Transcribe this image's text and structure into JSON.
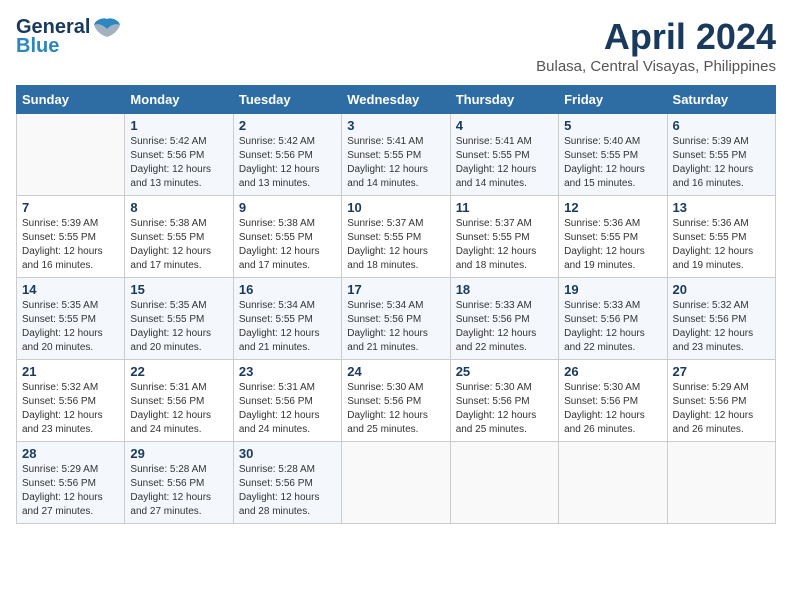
{
  "logo": {
    "line1": "General",
    "line2": "Blue"
  },
  "title": "April 2024",
  "subtitle": "Bulasa, Central Visayas, Philippines",
  "days_header": [
    "Sunday",
    "Monday",
    "Tuesday",
    "Wednesday",
    "Thursday",
    "Friday",
    "Saturday"
  ],
  "weeks": [
    [
      {
        "day": "",
        "info": ""
      },
      {
        "day": "1",
        "info": "Sunrise: 5:42 AM\nSunset: 5:56 PM\nDaylight: 12 hours\nand 13 minutes."
      },
      {
        "day": "2",
        "info": "Sunrise: 5:42 AM\nSunset: 5:56 PM\nDaylight: 12 hours\nand 13 minutes."
      },
      {
        "day": "3",
        "info": "Sunrise: 5:41 AM\nSunset: 5:55 PM\nDaylight: 12 hours\nand 14 minutes."
      },
      {
        "day": "4",
        "info": "Sunrise: 5:41 AM\nSunset: 5:55 PM\nDaylight: 12 hours\nand 14 minutes."
      },
      {
        "day": "5",
        "info": "Sunrise: 5:40 AM\nSunset: 5:55 PM\nDaylight: 12 hours\nand 15 minutes."
      },
      {
        "day": "6",
        "info": "Sunrise: 5:39 AM\nSunset: 5:55 PM\nDaylight: 12 hours\nand 16 minutes."
      }
    ],
    [
      {
        "day": "7",
        "info": "Sunrise: 5:39 AM\nSunset: 5:55 PM\nDaylight: 12 hours\nand 16 minutes."
      },
      {
        "day": "8",
        "info": "Sunrise: 5:38 AM\nSunset: 5:55 PM\nDaylight: 12 hours\nand 17 minutes."
      },
      {
        "day": "9",
        "info": "Sunrise: 5:38 AM\nSunset: 5:55 PM\nDaylight: 12 hours\nand 17 minutes."
      },
      {
        "day": "10",
        "info": "Sunrise: 5:37 AM\nSunset: 5:55 PM\nDaylight: 12 hours\nand 18 minutes."
      },
      {
        "day": "11",
        "info": "Sunrise: 5:37 AM\nSunset: 5:55 PM\nDaylight: 12 hours\nand 18 minutes."
      },
      {
        "day": "12",
        "info": "Sunrise: 5:36 AM\nSunset: 5:55 PM\nDaylight: 12 hours\nand 19 minutes."
      },
      {
        "day": "13",
        "info": "Sunrise: 5:36 AM\nSunset: 5:55 PM\nDaylight: 12 hours\nand 19 minutes."
      }
    ],
    [
      {
        "day": "14",
        "info": "Sunrise: 5:35 AM\nSunset: 5:55 PM\nDaylight: 12 hours\nand 20 minutes."
      },
      {
        "day": "15",
        "info": "Sunrise: 5:35 AM\nSunset: 5:55 PM\nDaylight: 12 hours\nand 20 minutes."
      },
      {
        "day": "16",
        "info": "Sunrise: 5:34 AM\nSunset: 5:55 PM\nDaylight: 12 hours\nand 21 minutes."
      },
      {
        "day": "17",
        "info": "Sunrise: 5:34 AM\nSunset: 5:56 PM\nDaylight: 12 hours\nand 21 minutes."
      },
      {
        "day": "18",
        "info": "Sunrise: 5:33 AM\nSunset: 5:56 PM\nDaylight: 12 hours\nand 22 minutes."
      },
      {
        "day": "19",
        "info": "Sunrise: 5:33 AM\nSunset: 5:56 PM\nDaylight: 12 hours\nand 22 minutes."
      },
      {
        "day": "20",
        "info": "Sunrise: 5:32 AM\nSunset: 5:56 PM\nDaylight: 12 hours\nand 23 minutes."
      }
    ],
    [
      {
        "day": "21",
        "info": "Sunrise: 5:32 AM\nSunset: 5:56 PM\nDaylight: 12 hours\nand 23 minutes."
      },
      {
        "day": "22",
        "info": "Sunrise: 5:31 AM\nSunset: 5:56 PM\nDaylight: 12 hours\nand 24 minutes."
      },
      {
        "day": "23",
        "info": "Sunrise: 5:31 AM\nSunset: 5:56 PM\nDaylight: 12 hours\nand 24 minutes."
      },
      {
        "day": "24",
        "info": "Sunrise: 5:30 AM\nSunset: 5:56 PM\nDaylight: 12 hours\nand 25 minutes."
      },
      {
        "day": "25",
        "info": "Sunrise: 5:30 AM\nSunset: 5:56 PM\nDaylight: 12 hours\nand 25 minutes."
      },
      {
        "day": "26",
        "info": "Sunrise: 5:30 AM\nSunset: 5:56 PM\nDaylight: 12 hours\nand 26 minutes."
      },
      {
        "day": "27",
        "info": "Sunrise: 5:29 AM\nSunset: 5:56 PM\nDaylight: 12 hours\nand 26 minutes."
      }
    ],
    [
      {
        "day": "28",
        "info": "Sunrise: 5:29 AM\nSunset: 5:56 PM\nDaylight: 12 hours\nand 27 minutes."
      },
      {
        "day": "29",
        "info": "Sunrise: 5:28 AM\nSunset: 5:56 PM\nDaylight: 12 hours\nand 27 minutes."
      },
      {
        "day": "30",
        "info": "Sunrise: 5:28 AM\nSunset: 5:56 PM\nDaylight: 12 hours\nand 28 minutes."
      },
      {
        "day": "",
        "info": ""
      },
      {
        "day": "",
        "info": ""
      },
      {
        "day": "",
        "info": ""
      },
      {
        "day": "",
        "info": ""
      }
    ]
  ]
}
